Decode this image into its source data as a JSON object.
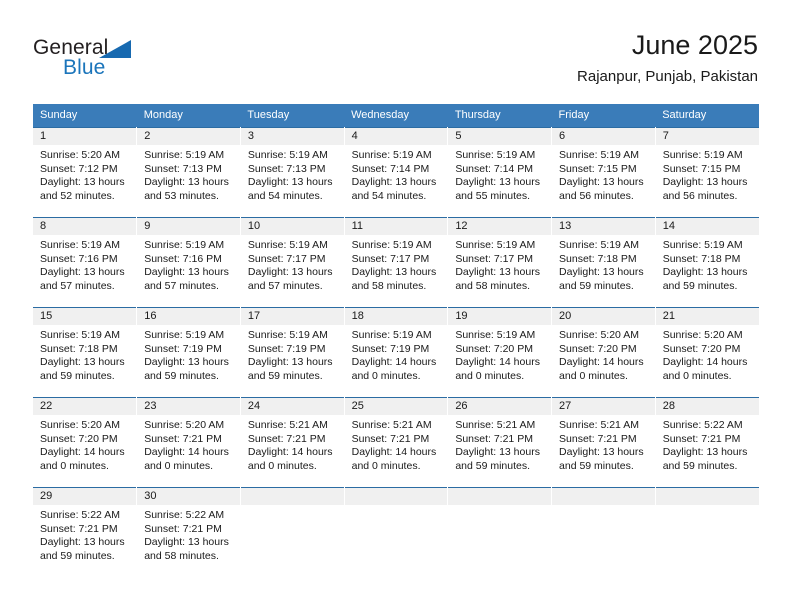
{
  "brand": {
    "name_part1": "General",
    "name_part2": "Blue"
  },
  "header": {
    "title": "June 2025",
    "subtitle": "Rajanpur, Punjab, Pakistan"
  },
  "colors": {
    "header_blue": "#3a7cb9",
    "separator_blue": "#2b6ca3",
    "daynum_band": "#f0f0f0",
    "brand_blue": "#1b75bb",
    "text": "#1a1a1a"
  },
  "weekday_headers": [
    "Sunday",
    "Monday",
    "Tuesday",
    "Wednesday",
    "Thursday",
    "Friday",
    "Saturday"
  ],
  "weeks": [
    [
      {
        "day": "1",
        "sunrise": "Sunrise: 5:20 AM",
        "sunset": "Sunset: 7:12 PM",
        "daylight1": "Daylight: 13 hours",
        "daylight2": "and 52 minutes."
      },
      {
        "day": "2",
        "sunrise": "Sunrise: 5:19 AM",
        "sunset": "Sunset: 7:13 PM",
        "daylight1": "Daylight: 13 hours",
        "daylight2": "and 53 minutes."
      },
      {
        "day": "3",
        "sunrise": "Sunrise: 5:19 AM",
        "sunset": "Sunset: 7:13 PM",
        "daylight1": "Daylight: 13 hours",
        "daylight2": "and 54 minutes."
      },
      {
        "day": "4",
        "sunrise": "Sunrise: 5:19 AM",
        "sunset": "Sunset: 7:14 PM",
        "daylight1": "Daylight: 13 hours",
        "daylight2": "and 54 minutes."
      },
      {
        "day": "5",
        "sunrise": "Sunrise: 5:19 AM",
        "sunset": "Sunset: 7:14 PM",
        "daylight1": "Daylight: 13 hours",
        "daylight2": "and 55 minutes."
      },
      {
        "day": "6",
        "sunrise": "Sunrise: 5:19 AM",
        "sunset": "Sunset: 7:15 PM",
        "daylight1": "Daylight: 13 hours",
        "daylight2": "and 56 minutes."
      },
      {
        "day": "7",
        "sunrise": "Sunrise: 5:19 AM",
        "sunset": "Sunset: 7:15 PM",
        "daylight1": "Daylight: 13 hours",
        "daylight2": "and 56 minutes."
      }
    ],
    [
      {
        "day": "8",
        "sunrise": "Sunrise: 5:19 AM",
        "sunset": "Sunset: 7:16 PM",
        "daylight1": "Daylight: 13 hours",
        "daylight2": "and 57 minutes."
      },
      {
        "day": "9",
        "sunrise": "Sunrise: 5:19 AM",
        "sunset": "Sunset: 7:16 PM",
        "daylight1": "Daylight: 13 hours",
        "daylight2": "and 57 minutes."
      },
      {
        "day": "10",
        "sunrise": "Sunrise: 5:19 AM",
        "sunset": "Sunset: 7:17 PM",
        "daylight1": "Daylight: 13 hours",
        "daylight2": "and 57 minutes."
      },
      {
        "day": "11",
        "sunrise": "Sunrise: 5:19 AM",
        "sunset": "Sunset: 7:17 PM",
        "daylight1": "Daylight: 13 hours",
        "daylight2": "and 58 minutes."
      },
      {
        "day": "12",
        "sunrise": "Sunrise: 5:19 AM",
        "sunset": "Sunset: 7:17 PM",
        "daylight1": "Daylight: 13 hours",
        "daylight2": "and 58 minutes."
      },
      {
        "day": "13",
        "sunrise": "Sunrise: 5:19 AM",
        "sunset": "Sunset: 7:18 PM",
        "daylight1": "Daylight: 13 hours",
        "daylight2": "and 59 minutes."
      },
      {
        "day": "14",
        "sunrise": "Sunrise: 5:19 AM",
        "sunset": "Sunset: 7:18 PM",
        "daylight1": "Daylight: 13 hours",
        "daylight2": "and 59 minutes."
      }
    ],
    [
      {
        "day": "15",
        "sunrise": "Sunrise: 5:19 AM",
        "sunset": "Sunset: 7:18 PM",
        "daylight1": "Daylight: 13 hours",
        "daylight2": "and 59 minutes."
      },
      {
        "day": "16",
        "sunrise": "Sunrise: 5:19 AM",
        "sunset": "Sunset: 7:19 PM",
        "daylight1": "Daylight: 13 hours",
        "daylight2": "and 59 minutes."
      },
      {
        "day": "17",
        "sunrise": "Sunrise: 5:19 AM",
        "sunset": "Sunset: 7:19 PM",
        "daylight1": "Daylight: 13 hours",
        "daylight2": "and 59 minutes."
      },
      {
        "day": "18",
        "sunrise": "Sunrise: 5:19 AM",
        "sunset": "Sunset: 7:19 PM",
        "daylight1": "Daylight: 14 hours",
        "daylight2": "and 0 minutes."
      },
      {
        "day": "19",
        "sunrise": "Sunrise: 5:19 AM",
        "sunset": "Sunset: 7:20 PM",
        "daylight1": "Daylight: 14 hours",
        "daylight2": "and 0 minutes."
      },
      {
        "day": "20",
        "sunrise": "Sunrise: 5:20 AM",
        "sunset": "Sunset: 7:20 PM",
        "daylight1": "Daylight: 14 hours",
        "daylight2": "and 0 minutes."
      },
      {
        "day": "21",
        "sunrise": "Sunrise: 5:20 AM",
        "sunset": "Sunset: 7:20 PM",
        "daylight1": "Daylight: 14 hours",
        "daylight2": "and 0 minutes."
      }
    ],
    [
      {
        "day": "22",
        "sunrise": "Sunrise: 5:20 AM",
        "sunset": "Sunset: 7:20 PM",
        "daylight1": "Daylight: 14 hours",
        "daylight2": "and 0 minutes."
      },
      {
        "day": "23",
        "sunrise": "Sunrise: 5:20 AM",
        "sunset": "Sunset: 7:21 PM",
        "daylight1": "Daylight: 14 hours",
        "daylight2": "and 0 minutes."
      },
      {
        "day": "24",
        "sunrise": "Sunrise: 5:21 AM",
        "sunset": "Sunset: 7:21 PM",
        "daylight1": "Daylight: 14 hours",
        "daylight2": "and 0 minutes."
      },
      {
        "day": "25",
        "sunrise": "Sunrise: 5:21 AM",
        "sunset": "Sunset: 7:21 PM",
        "daylight1": "Daylight: 14 hours",
        "daylight2": "and 0 minutes."
      },
      {
        "day": "26",
        "sunrise": "Sunrise: 5:21 AM",
        "sunset": "Sunset: 7:21 PM",
        "daylight1": "Daylight: 13 hours",
        "daylight2": "and 59 minutes."
      },
      {
        "day": "27",
        "sunrise": "Sunrise: 5:21 AM",
        "sunset": "Sunset: 7:21 PM",
        "daylight1": "Daylight: 13 hours",
        "daylight2": "and 59 minutes."
      },
      {
        "day": "28",
        "sunrise": "Sunrise: 5:22 AM",
        "sunset": "Sunset: 7:21 PM",
        "daylight1": "Daylight: 13 hours",
        "daylight2": "and 59 minutes."
      }
    ],
    [
      {
        "day": "29",
        "sunrise": "Sunrise: 5:22 AM",
        "sunset": "Sunset: 7:21 PM",
        "daylight1": "Daylight: 13 hours",
        "daylight2": "and 59 minutes."
      },
      {
        "day": "30",
        "sunrise": "Sunrise: 5:22 AM",
        "sunset": "Sunset: 7:21 PM",
        "daylight1": "Daylight: 13 hours",
        "daylight2": "and 58 minutes."
      },
      {
        "day": "",
        "sunrise": "",
        "sunset": "",
        "daylight1": "",
        "daylight2": ""
      },
      {
        "day": "",
        "sunrise": "",
        "sunset": "",
        "daylight1": "",
        "daylight2": ""
      },
      {
        "day": "",
        "sunrise": "",
        "sunset": "",
        "daylight1": "",
        "daylight2": ""
      },
      {
        "day": "",
        "sunrise": "",
        "sunset": "",
        "daylight1": "",
        "daylight2": ""
      },
      {
        "day": "",
        "sunrise": "",
        "sunset": "",
        "daylight1": "",
        "daylight2": ""
      }
    ]
  ]
}
